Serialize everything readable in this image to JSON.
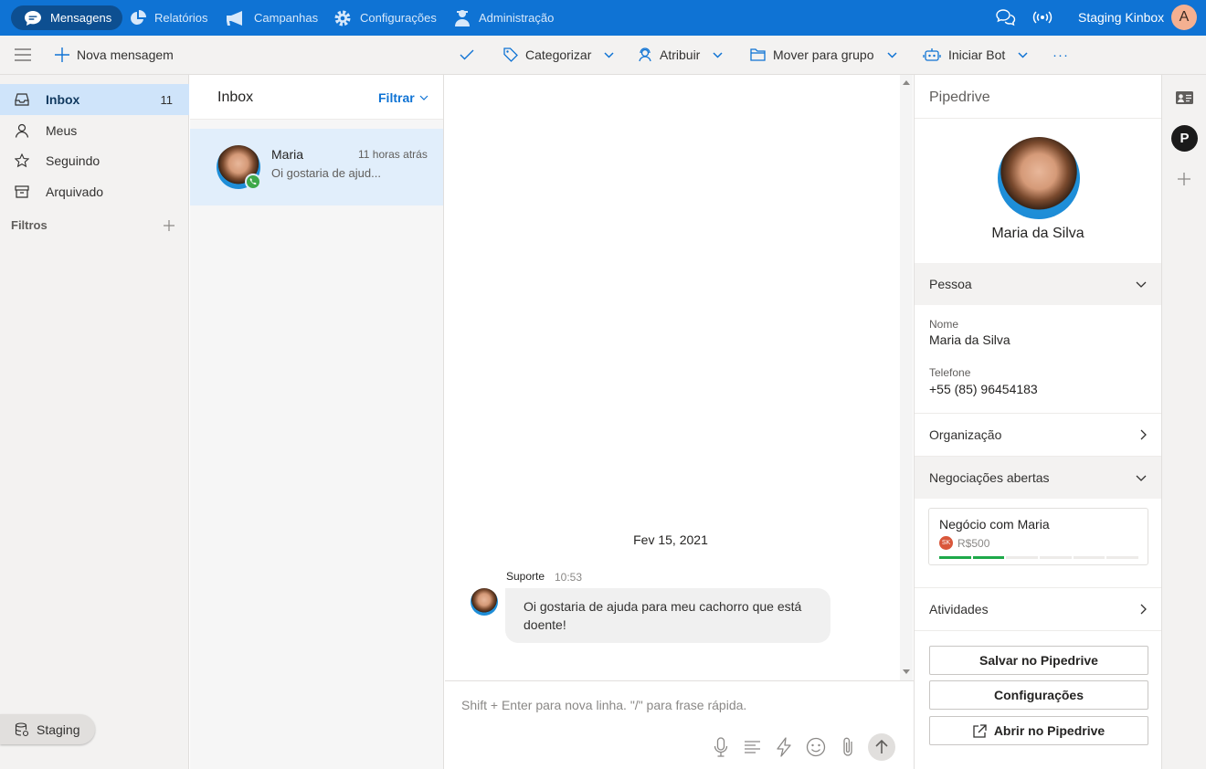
{
  "topnav": {
    "items": [
      {
        "label": "Mensagens",
        "icon": "chat-bubble-icon",
        "active": true
      },
      {
        "label": "Relatórios",
        "icon": "pie-chart-icon"
      },
      {
        "label": "Campanhas",
        "icon": "megaphone-icon"
      },
      {
        "label": "Configurações",
        "icon": "gear-icon"
      },
      {
        "label": "Administração",
        "icon": "admin-user-icon"
      }
    ],
    "account_name": "Staging Kinbox",
    "avatar_initial": "A"
  },
  "toolbar": {
    "new_message": "Nova mensagem",
    "categorize": "Categorizar",
    "assign": "Atribuir",
    "move_group": "Mover para grupo",
    "start_bot": "Iniciar Bot",
    "more": "···"
  },
  "sidebar": {
    "items": [
      {
        "label": "Inbox",
        "count": "11",
        "icon": "inbox-icon"
      },
      {
        "label": "Meus",
        "icon": "person-icon"
      },
      {
        "label": "Seguindo",
        "icon": "star-icon"
      },
      {
        "label": "Arquivado",
        "icon": "archive-icon"
      }
    ],
    "filters_title": "Filtros",
    "environment": "Staging"
  },
  "inbox": {
    "title": "Inbox",
    "filter_label": "Filtrar",
    "conversations": [
      {
        "name": "Maria",
        "time": "11 horas atrás",
        "preview": "Oi gostaria de ajud...",
        "channel_icon": "whatsapp-icon"
      }
    ]
  },
  "chat": {
    "date_divider": "Fev 15, 2021",
    "messages": [
      {
        "sender": "Suporte",
        "time": "10:53",
        "text": "Oi gostaria de ajuda para meu cachorro que está doente!"
      }
    ],
    "composer_placeholder": "Shift + Enter para nova linha. \"/\" para frase rápida."
  },
  "pipedrive": {
    "title": "Pipedrive",
    "contact_name": "Maria da Silva",
    "person_section": "Pessoa",
    "fields": [
      {
        "label": "Nome",
        "value": "Maria da Silva"
      },
      {
        "label": "Telefone",
        "value": "+55 (85) 96454183"
      }
    ],
    "organization_section": "Organização",
    "deals_section": "Negociações abertas",
    "deal": {
      "title": "Negócio com Maria",
      "owner_initials": "SK",
      "value": "R$500",
      "stages_total": 6,
      "stages_done": 2
    },
    "activities_section": "Atividades",
    "buttons": {
      "save": "Salvar no Pipedrive",
      "settings": "Configurações",
      "open": "Abrir no Pipedrive"
    }
  },
  "colors": {
    "brand_blue": "#0f73d4",
    "active_nav": "#0d4f91",
    "selected_row": "#e1eefb",
    "deal_progress": "#1ea94a"
  }
}
